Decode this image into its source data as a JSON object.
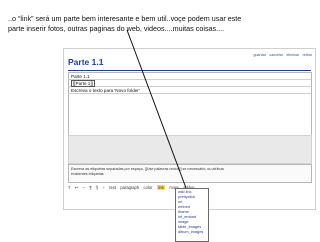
{
  "caption": {
    "line1": "..o “link” será um parte bem interesante e bem util..voçe podem usar este",
    "line2": "parte inserir fotos, outras paginas do web, videos....muitas coisas...."
  },
  "window": {
    "page_title": "Parte 1.1",
    "actions": [
      "guardar",
      "cancelar",
      "eliminar",
      "retirar"
    ],
    "editor_lines": [
      "Parte 1.1",
      "[[Parte 1]]",
      "Escreva o texto para 'Novo folder'"
    ],
    "tags_hint_line1": "Escreva as etiquetas separadas por espaço, [[Use palavras rectos]] se necessário, ou atribua",
    "tags_hint_line2": "existentes etiquetas",
    "toolbar_items": [
      "?",
      "↩",
      "–",
      "¶",
      "§",
      "÷",
      "text",
      "paragraph",
      "color",
      "link",
      "more",
      "addon"
    ],
    "active_toolbar_item": "link"
  },
  "dropdown": {
    "options": [
      "wiki link",
      "prettyclick",
      "url",
      "embed",
      "iframe",
      "int_embed",
      "image",
      "table_images",
      "album_images"
    ]
  },
  "colors": {
    "title": "#1f3f8a",
    "link": "#2255aa",
    "highlight": "#ffe44a",
    "panel_gray": "#e9e9e9"
  }
}
